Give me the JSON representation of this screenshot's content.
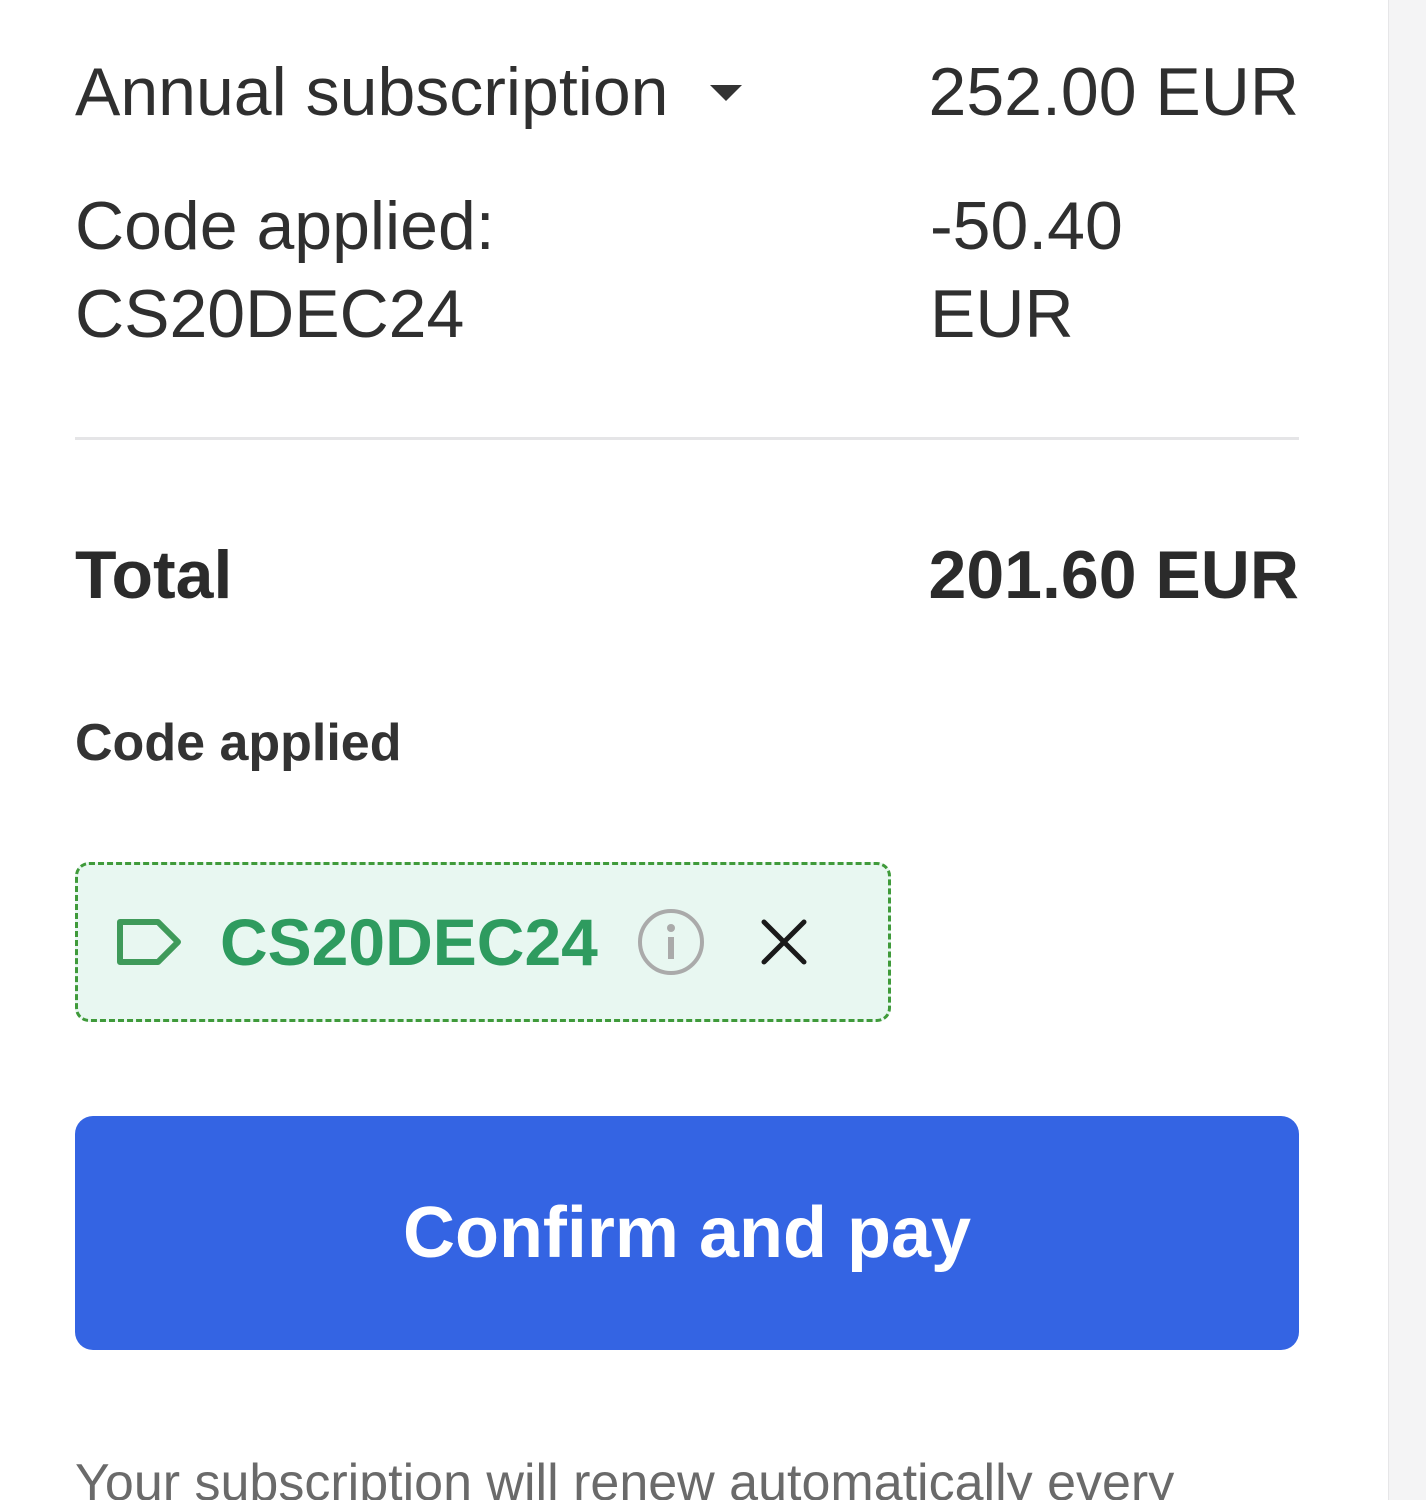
{
  "summary": {
    "plan_label": "Annual subscription",
    "plan_price": "252.00 EUR",
    "discount_label_line1": "Code applied:",
    "discount_label_line2": "CS20DEC24",
    "discount_amount_line1": "-50.40",
    "discount_amount_line2": "EUR",
    "total_label": "Total",
    "total_value": "201.60 EUR"
  },
  "promo": {
    "heading": "Code applied",
    "code": "CS20DEC24",
    "tag_icon": "tag-icon",
    "info_icon": "info-icon",
    "remove_icon": "close-icon"
  },
  "actions": {
    "pay_label": "Confirm and pay"
  },
  "footer": {
    "renew_note": "Your subscription will renew automatically every"
  },
  "colors": {
    "primary": "#3464e3",
    "success_text": "#2e9b5f",
    "success_border": "#3f9a3a",
    "success_bg": "#e8f7f1"
  }
}
